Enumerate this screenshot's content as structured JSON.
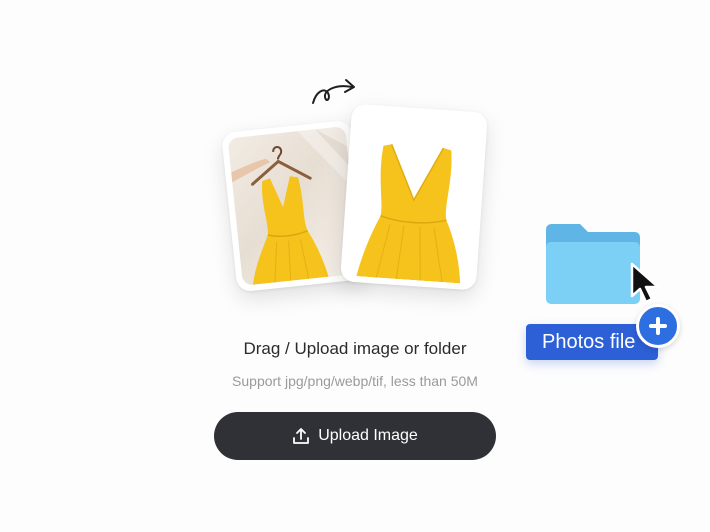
{
  "dropzone": {
    "headline": "Drag / Upload image or folder",
    "subtext": "Support jpg/png/webp/tif, less than 50M",
    "upload_button_label": "Upload Image",
    "upload_icon": "upload-icon"
  },
  "illustration": {
    "folder_badge_label": "Photos file",
    "folder_icon": "folder-icon",
    "cursor_icon": "cursor-arrow-icon",
    "add_icon": "plus-circle-icon",
    "arrow_icon": "curly-arrow-icon",
    "colors": {
      "folder": "#7ccff5",
      "folder_tab": "#5fb6e6",
      "badge": "#2d5fd6",
      "plus": "#2d6fe0",
      "dress": "#f5c31c",
      "button": "#2f3136"
    }
  }
}
